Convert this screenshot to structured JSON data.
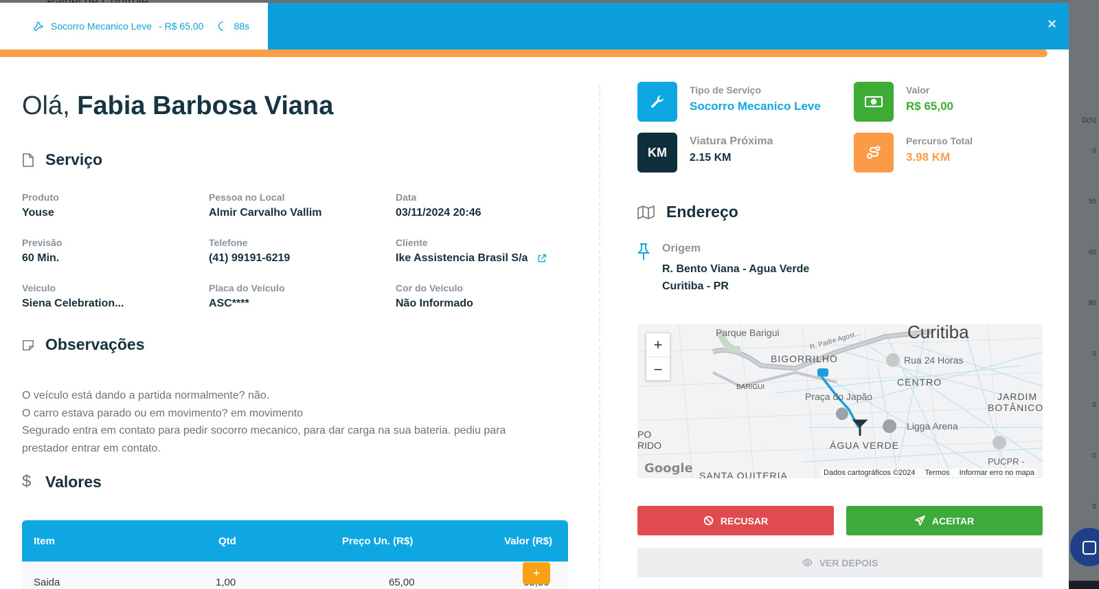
{
  "backdrop": {
    "title": "Painel de Controle",
    "right_values": [
      "D(S)",
      "0",
      "50",
      "60",
      "80",
      "0",
      "0",
      "0",
      "0",
      "0"
    ]
  },
  "header": {
    "service_label": "Socorro Mecanico Leve",
    "price_label": "- R$ 65,00",
    "timer": "88s",
    "close_symbol": "×",
    "progress_fraction": 0.98
  },
  "greeting": {
    "prefix": "Olá,",
    "name": "Fabia Barbosa Viana"
  },
  "servico": {
    "title": "Serviço",
    "fields": [
      {
        "label": "Produto",
        "value": "Youse"
      },
      {
        "label": "Pessoa no Local",
        "value": "Almir Carvalho Vallim"
      },
      {
        "label": "Data",
        "value": "03/11/2024 20:46"
      },
      {
        "label": "Previsão",
        "value": "60 Min."
      },
      {
        "label": "Telefone",
        "value": "(41) 99191-6219"
      },
      {
        "label": "Cliente",
        "value": "Ike Assistencia Brasil S/a"
      },
      {
        "label": "Veículo",
        "value": "Siena Celebration..."
      },
      {
        "label": "Placa do Veículo",
        "value": "ASC****"
      },
      {
        "label": "Cor do Veículo",
        "value": "Não Informado"
      }
    ]
  },
  "observacoes": {
    "title": "Observações",
    "lines": [
      "O veículo está dando a partida normalmente? não.",
      "O carro estava parado ou em movimento? em movimento",
      "Segurado entra em contato para pedir socorro mecanico, para dar carga na sua bateria. pediu para",
      "prestador entrar em contato."
    ]
  },
  "valores": {
    "title": "Valores",
    "columns": [
      "Item",
      "Qtd",
      "Preço Un. (R$)",
      "Valor (R$)"
    ],
    "rows": [
      {
        "item": "Saida",
        "qtd": "1,00",
        "preco": "65,00",
        "valor": "65,00"
      }
    ],
    "add_symbol": "+"
  },
  "stats": [
    {
      "label": "Tipo de Serviço",
      "value": "Socorro Mecanico Leve",
      "color": "#0ea7e2",
      "icon": "wrench-icon"
    },
    {
      "label": "Valor",
      "value": "R$ 65,00",
      "color": "#3dac34",
      "icon": "money-icon"
    },
    {
      "label": "Viatura Próxima",
      "value": "2.15 KM",
      "color": "#0f2f3d",
      "icon": "km-icon",
      "icon_text": "KM"
    },
    {
      "label": "Percurso Total",
      "value": "3.98 KM",
      "color": "#fb9a47",
      "icon": "route-icon"
    }
  ],
  "endereco": {
    "title": "Endereço",
    "origem_label": "Origem",
    "line1": "R. Bento Viana - Agua Verde",
    "line2": "Curitiba - PR"
  },
  "map": {
    "labels": {
      "parque": "Parque Barigui",
      "padre": "R. Padre Agost...",
      "curitiba": "Curitiba",
      "bigorrilho": "BIGORRILHO",
      "rua24": "Rua 24 Horas",
      "centro": "CENTRO",
      "barigui": "BARIGUI",
      "praca": "Praça do Japão",
      "jardim": "JARDIM",
      "botanico": "BOTÂNICO",
      "ligga": "Ligga Arena",
      "po": "PO",
      "rido": "RIDO",
      "agua_verde": "ÁGUA VERDE",
      "pucpr": "PUCPR -",
      "santa": "SANTA QUITERIA"
    },
    "zoom_in": "+",
    "zoom_out": "−",
    "google": "Google",
    "footer": {
      "data": "Dados cartográficos ©2024",
      "terms": "Termos",
      "report": "Informar erro no mapa"
    }
  },
  "actions": {
    "recusar": "RECUSAR",
    "aceitar": "ACEITAR",
    "ver_depois": "VER DEPOIS"
  }
}
